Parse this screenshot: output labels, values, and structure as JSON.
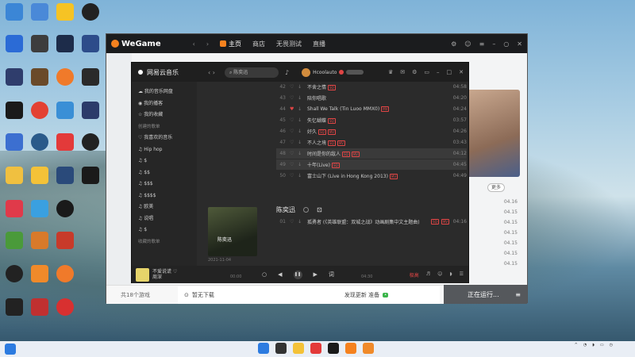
{
  "wegame": {
    "logo": "WeGame",
    "nav": [
      "主页",
      "商店",
      "无畏测试",
      "直播"
    ],
    "bottom_count": "共18个游戏",
    "bottom_download": "暂无下载",
    "bottom_mid": "发现更新 准备",
    "running": "正在运行...",
    "more": "更多",
    "list_times": [
      "04.16",
      "04.15",
      "04.15",
      "04.15",
      "04.15",
      "04.15",
      "04.15"
    ]
  },
  "netease": {
    "logo": "网易云音乐",
    "search_placeholder": "陈奕迅",
    "username": "Hcoolauto",
    "sidebar": [
      {
        "label": "我的音乐网盘",
        "sec": false
      },
      {
        "label": "我的播客",
        "sec": false
      },
      {
        "label": "我的收藏",
        "sec": false
      },
      {
        "label": "创建的歌单",
        "sec": true
      },
      {
        "label": "我喜欢的音乐",
        "sec": false
      },
      {
        "label": "Hip hop",
        "sec": false
      },
      {
        "label": "$",
        "sec": false
      },
      {
        "label": "$$",
        "sec": false
      },
      {
        "label": "$$$",
        "sec": false
      },
      {
        "label": "$$$$",
        "sec": false
      },
      {
        "label": "欧美",
        "sec": false
      },
      {
        "label": "说唱",
        "sec": false
      },
      {
        "label": "$",
        "sec": false
      },
      {
        "label": "收藏的歌单",
        "sec": true
      }
    ],
    "songs": [
      {
        "num": "42",
        "title": "不舍之情",
        "badges": [
          "SQ"
        ],
        "duration": "04:58",
        "liked": false
      },
      {
        "num": "43",
        "title": "陪你唱歌",
        "badges": [],
        "duration": "04:20",
        "liked": false
      },
      {
        "num": "44",
        "title": "Shall We Talk (Tin Luoo MMX0)",
        "badges": [
          "MV"
        ],
        "duration": "04:24",
        "liked": true
      },
      {
        "num": "45",
        "title": "失忆蝴蝶",
        "badges": [
          "SQ"
        ],
        "duration": "03:57",
        "liked": false
      },
      {
        "num": "46",
        "title": "好久",
        "badges": [
          "SQ",
          "MV"
        ],
        "duration": "04:26",
        "liked": false
      },
      {
        "num": "47",
        "title": "不人之境",
        "badges": [
          "SQ",
          "MV"
        ],
        "duration": "03:43",
        "liked": false
      },
      {
        "num": "48",
        "title": "时间是你的敌人",
        "badges": [
          "SQ",
          "MV"
        ],
        "duration": "04:12",
        "liked": false
      },
      {
        "num": "49",
        "title": "十年(Live)",
        "badges": [
          "SQ"
        ],
        "duration": "04:45",
        "liked": false
      },
      {
        "num": "50",
        "title": "富士山下 (Live in Hong Kong 2013)",
        "badges": [
          "MV"
        ],
        "duration": "04:49",
        "liked": false
      }
    ],
    "artist": "陈奕迅",
    "album_cover_text": "陈奕迅",
    "album_date": "2021-11-04",
    "album_song": {
      "num": "01",
      "title": "孤勇者 (《英雄联盟：双城之战》动画剧集中文主题曲)",
      "badges": [
        "SQ",
        "MV"
      ],
      "duration": "04:16"
    },
    "player": {
      "title": "不爱说谎 ♡",
      "artist": "周深",
      "time_now": "00:00",
      "time_total": "04:30",
      "quality": "极高"
    }
  }
}
